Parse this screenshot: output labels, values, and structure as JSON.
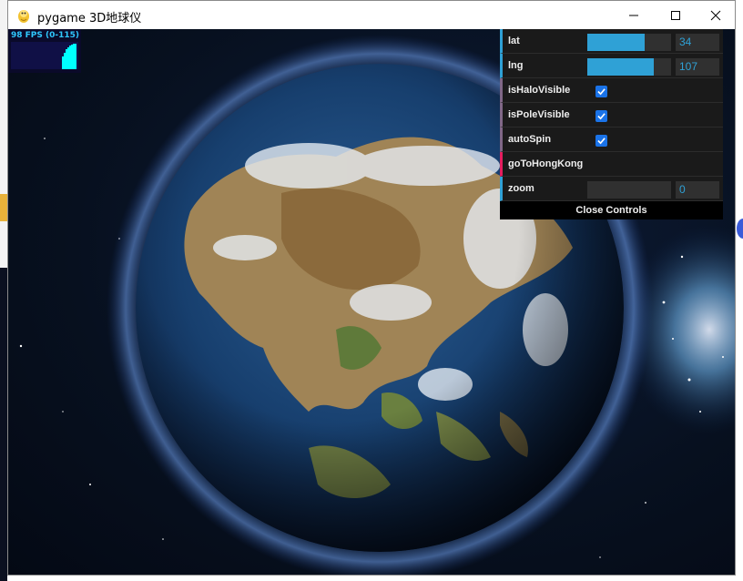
{
  "window": {
    "title": "pygame 3D地球仪"
  },
  "fps": {
    "text": "98 FPS (0-115)"
  },
  "controls": {
    "lat": {
      "label": "lat",
      "value": "34",
      "fraction": 0.68
    },
    "lng": {
      "label": "lng",
      "value": "107",
      "fraction": 0.79
    },
    "isHaloVisible": {
      "label": "isHaloVisible",
      "checked": true
    },
    "isPoleVisible": {
      "label": "isPoleVisible",
      "checked": true
    },
    "autoSpin": {
      "label": "autoSpin",
      "checked": true
    },
    "goToHongKong": {
      "label": "goToHongKong"
    },
    "zoom": {
      "label": "zoom",
      "value": "0",
      "fraction": 0
    },
    "close_label": "Close Controls"
  },
  "colors": {
    "number_accent": "#2fa1d6",
    "function_accent": "#e61d5f",
    "checkbox": "#1a73e8"
  }
}
